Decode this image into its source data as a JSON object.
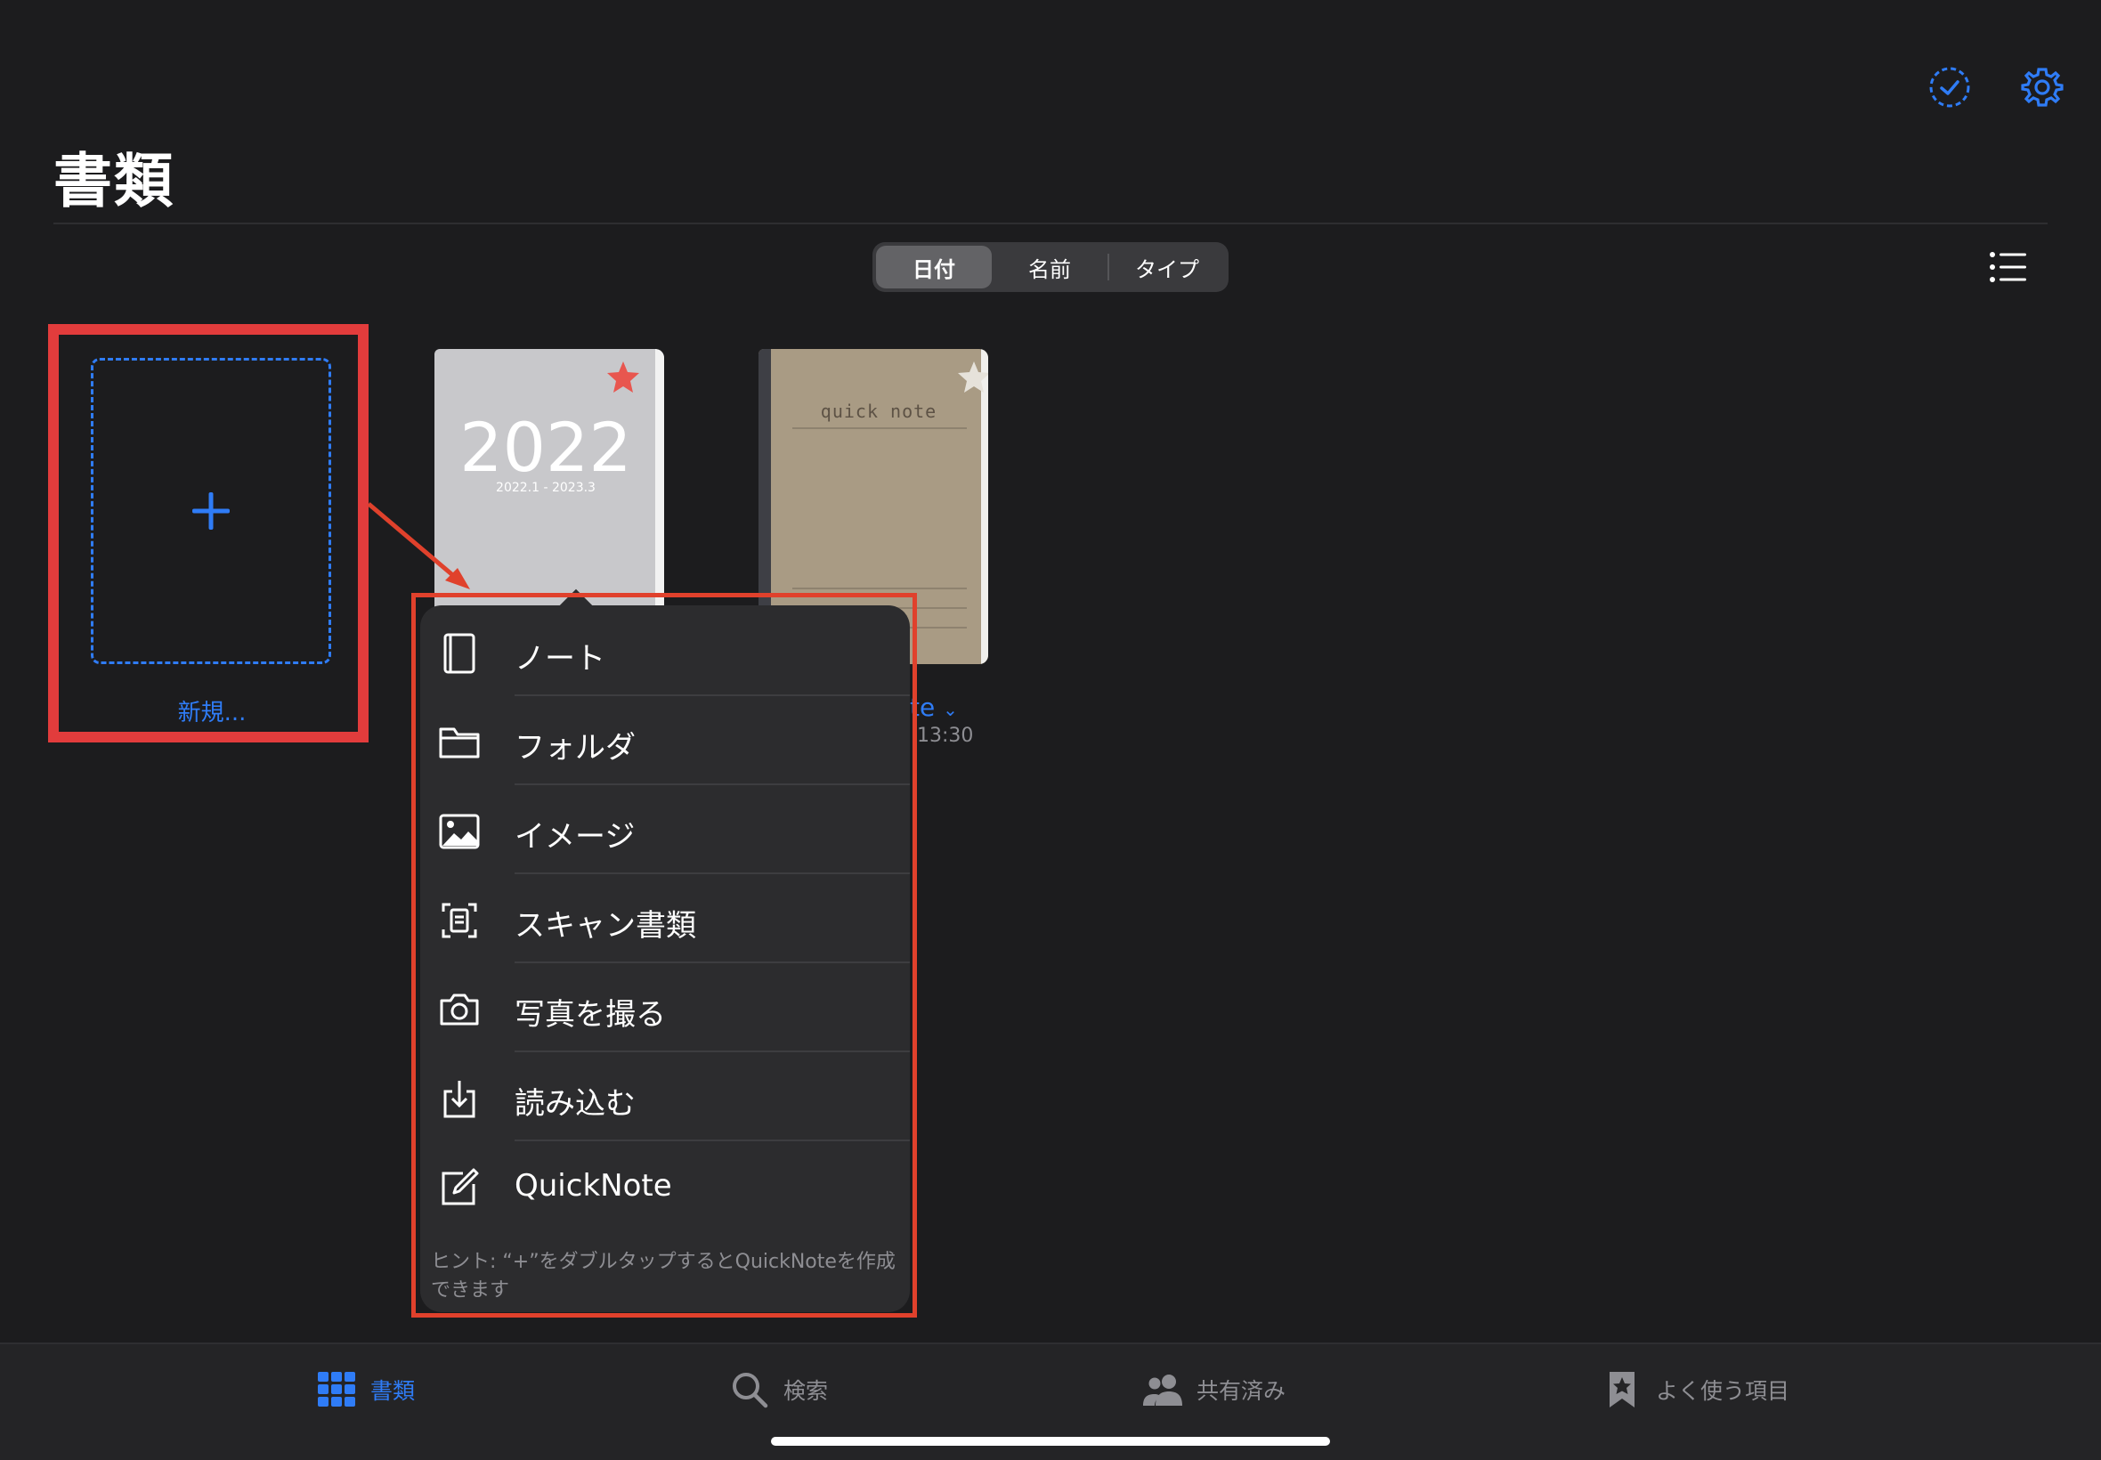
{
  "page_title": "書類",
  "segments": [
    {
      "label": "日付",
      "active": true
    },
    {
      "label": "名前",
      "active": false
    },
    {
      "label": "タイプ",
      "active": false
    }
  ],
  "new_tile": {
    "label": "新規..."
  },
  "covers": [
    {
      "year": "2022",
      "range": "2022.1 - 2023.3",
      "favorite": true
    },
    {
      "title": "quick note",
      "favorite": false
    }
  ],
  "partial_doc": {
    "name_fragment": "te",
    "time_fragment": "13:30"
  },
  "menu": {
    "items": [
      {
        "label": "ノート",
        "icon": "notebook-icon"
      },
      {
        "label": "フォルダ",
        "icon": "folder-icon"
      },
      {
        "label": "イメージ",
        "icon": "image-icon"
      },
      {
        "label": "スキャン書類",
        "icon": "scan-document-icon"
      },
      {
        "label": "写真を撮る",
        "icon": "camera-icon"
      },
      {
        "label": "読み込む",
        "icon": "import-icon"
      },
      {
        "label": "QuickNote",
        "icon": "quicknote-icon"
      }
    ],
    "hint": "ヒント: “+”をダブルタップするとQuickNoteを作成できます"
  },
  "tabs": [
    {
      "label": "書類",
      "icon": "grid-icon",
      "active": true
    },
    {
      "label": "検索",
      "icon": "search-icon",
      "active": false
    },
    {
      "label": "共有済み",
      "icon": "people-icon",
      "active": false
    },
    {
      "label": "よく使う項目",
      "icon": "bookmark-star-icon",
      "active": false
    }
  ],
  "colors": {
    "accent": "#2f7cf6",
    "highlight": "#e23c3c",
    "star": "#e8564f"
  }
}
